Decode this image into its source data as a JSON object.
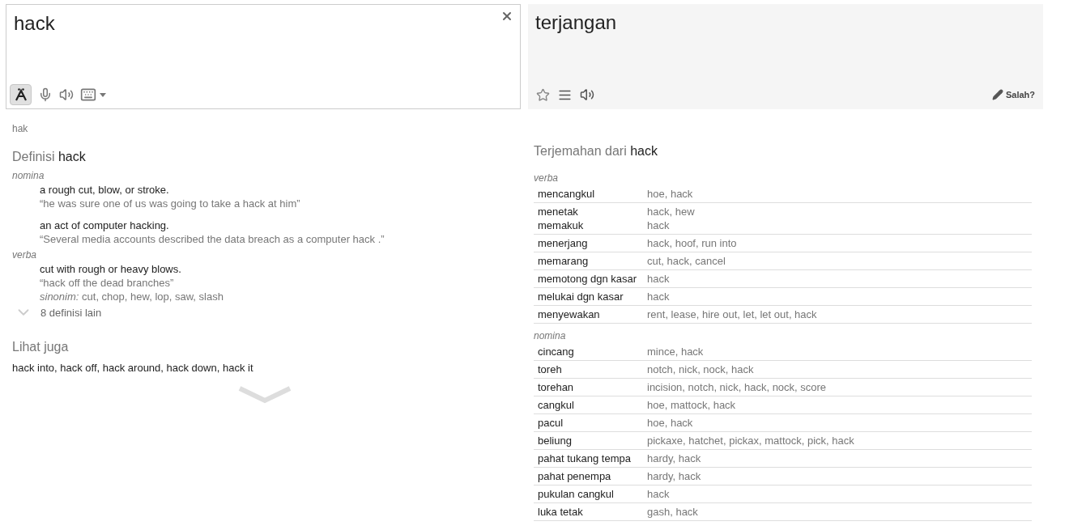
{
  "source": {
    "text": "hack",
    "input_tools_selected": true
  },
  "target": {
    "text": "terjangan",
    "wrong_label": "Salah?"
  },
  "transliteration": "hak",
  "definitions": {
    "heading": "Definisi",
    "word": "hack",
    "groups": [
      {
        "pos": "nomina",
        "senses": [
          {
            "gloss": "a rough cut, blow, or stroke.",
            "example": "“he was sure one of us was going to take a hack at him”"
          },
          {
            "gloss": "an act of computer hacking.",
            "example": "“Several media accounts described the data breach as a computer hack .”"
          }
        ]
      },
      {
        "pos": "verba",
        "senses": [
          {
            "gloss": "cut with rough or heavy blows.",
            "example": "“hack off the dead branches”",
            "synonyms_label": "sinonim:",
            "synonyms": "cut, chop, hew, lop, saw, slash"
          }
        ]
      }
    ],
    "more": "8 definisi lain"
  },
  "see_also": {
    "heading": "Lihat juga",
    "text": "hack into, hack off, hack around, hack down, hack it"
  },
  "translations": {
    "heading": "Terjemahan dari",
    "word": "hack",
    "groups": [
      {
        "pos": "verba",
        "rows": [
          {
            "lines": [
              {
                "term": "mencangkul",
                "words": "hoe, hack"
              }
            ]
          },
          {
            "lines": [
              {
                "term": "menetak",
                "words": "hack, hew"
              },
              {
                "term": "memakuk",
                "words": "hack"
              }
            ]
          },
          {
            "lines": [
              {
                "term": "menerjang",
                "words": "hack, hoof, run into"
              }
            ]
          },
          {
            "lines": [
              {
                "term": "memarang",
                "words": "cut, hack, cancel"
              }
            ]
          },
          {
            "lines": [
              {
                "term": "memotong dgn kasar",
                "words": "hack"
              }
            ]
          },
          {
            "lines": [
              {
                "term": "melukai dgn kasar",
                "words": "hack"
              }
            ]
          },
          {
            "lines": [
              {
                "term": "menyewakan",
                "words": "rent, lease, hire out, let, let out, hack"
              }
            ]
          }
        ]
      },
      {
        "pos": "nomina",
        "rows": [
          {
            "lines": [
              {
                "term": "cincang",
                "words": "mince, hack"
              }
            ]
          },
          {
            "lines": [
              {
                "term": "toreh",
                "words": "notch, nick, nock, hack"
              }
            ]
          },
          {
            "lines": [
              {
                "term": "torehan",
                "words": "incision, notch, nick, hack, nock, score"
              }
            ]
          },
          {
            "lines": [
              {
                "term": "cangkul",
                "words": "hoe, mattock, hack"
              }
            ]
          },
          {
            "lines": [
              {
                "term": "pacul",
                "words": "hoe, hack"
              }
            ]
          },
          {
            "lines": [
              {
                "term": "beliung",
                "words": "pickaxe, hatchet, pickax, mattock, pick, hack"
              }
            ]
          },
          {
            "lines": [
              {
                "term": "pahat tukang tempa",
                "words": "hardy, hack"
              }
            ]
          },
          {
            "lines": [
              {
                "term": "pahat penempa",
                "words": "hardy, hack"
              }
            ]
          },
          {
            "lines": [
              {
                "term": "pukulan cangkul",
                "words": "hack"
              }
            ]
          },
          {
            "lines": [
              {
                "term": "luka tetak",
                "words": "gash, hack"
              }
            ]
          }
        ]
      }
    ]
  }
}
